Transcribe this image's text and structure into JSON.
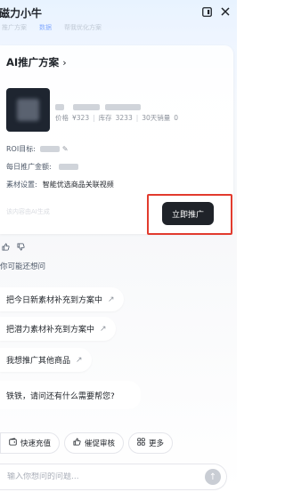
{
  "header": {
    "title": "磁力小牛",
    "sidebar_icon": "panel-icon",
    "close_icon": "close-icon"
  },
  "tabs": [
    {
      "label": "推广方案"
    },
    {
      "label": "数据"
    },
    {
      "label": "帮我优化方案"
    }
  ],
  "card": {
    "title": "AI推广方案",
    "product": {
      "price_label": "价格",
      "price": "¥323",
      "stock_label": "库存",
      "stock": "3233",
      "sales_label": "30天销量",
      "sales": "0"
    },
    "roi_label": "ROI目标:",
    "budget_label": "每日推广金额:",
    "material_label": "素材设置:",
    "material_value": "智能优选商品关联视频",
    "note": "该内容由AI生成",
    "promote_button": "立即推广"
  },
  "maybe_ask": "你可能还想问",
  "suggestions": [
    {
      "label": "把今日新素材补充到方案中"
    },
    {
      "label": "把潜力素材补充到方案中"
    },
    {
      "label": "我想推广其他商品"
    }
  ],
  "bot_message": "铁铁，请问还有什么需要帮您?",
  "quick_actions": [
    {
      "label": "快速充值",
      "icon": "wallet-icon"
    },
    {
      "label": "催促审核",
      "icon": "thumbs-up-icon"
    },
    {
      "label": "更多",
      "icon": "grid-icon"
    }
  ],
  "input": {
    "placeholder": "输入你想问的问题..."
  },
  "colors": {
    "primary_button": "#1f2329",
    "highlight": "#e23b2e",
    "accent": "#3370ff"
  }
}
